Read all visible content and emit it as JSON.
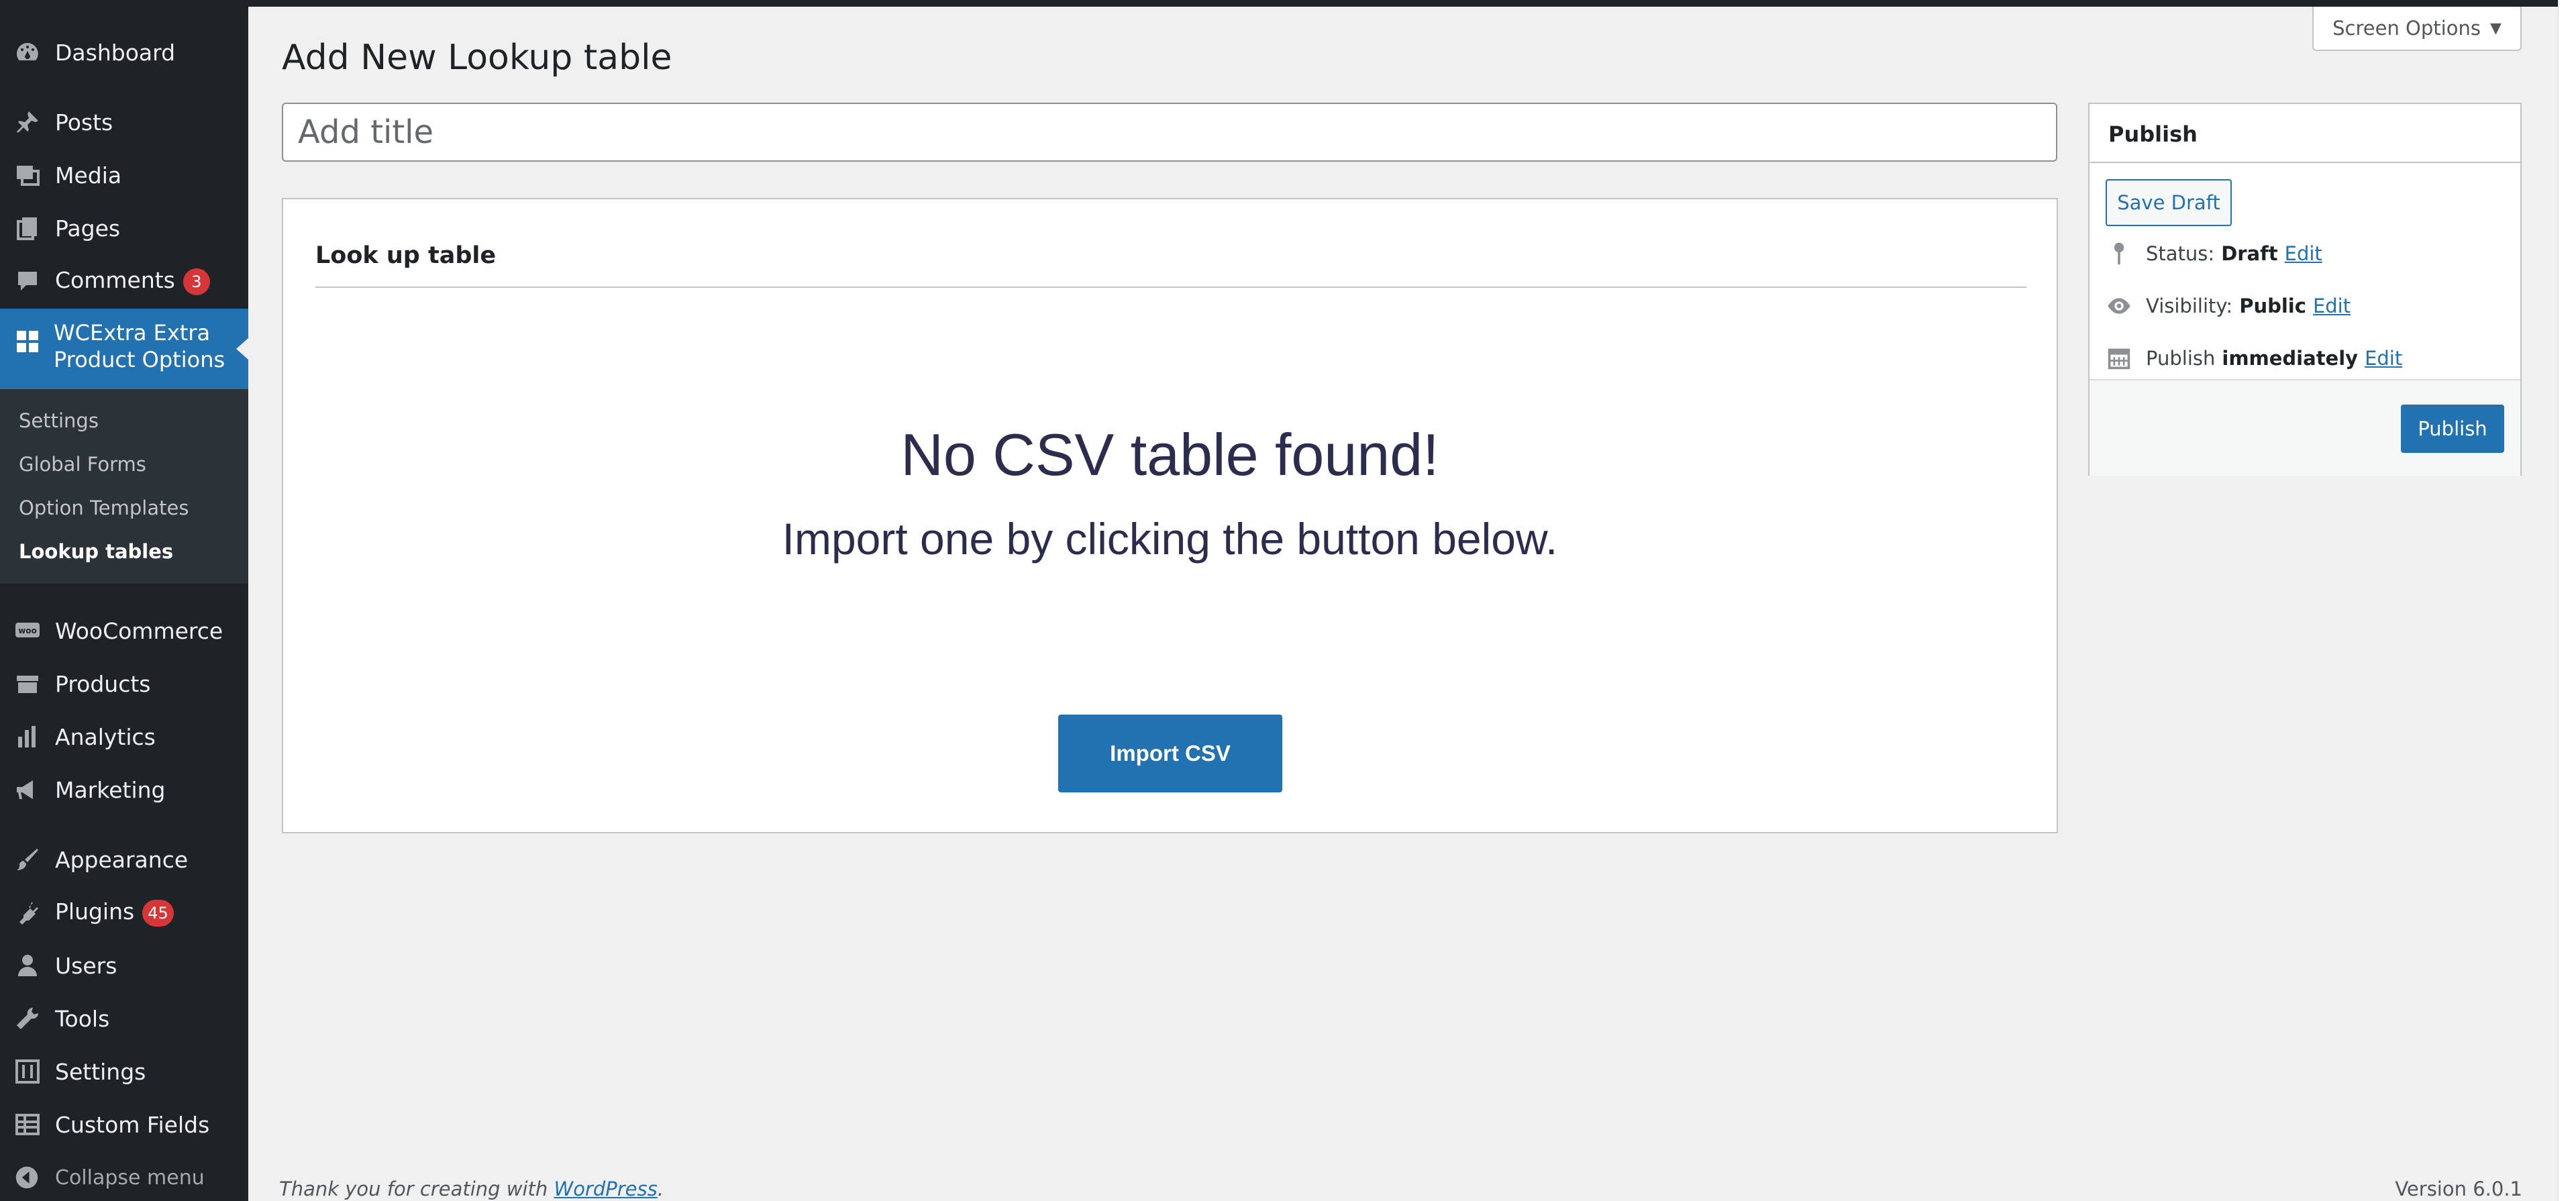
{
  "sidebar": {
    "items_top": [
      {
        "label": "Dashboard",
        "icon": "dashboard-icon"
      },
      {
        "label": "Posts",
        "icon": "pin-icon"
      },
      {
        "label": "Media",
        "icon": "media-icon"
      },
      {
        "label": "Pages",
        "icon": "pages-icon"
      },
      {
        "label": "Comments",
        "icon": "comment-icon",
        "badge": "3"
      }
    ],
    "active": {
      "label": "WCExtra Extra Product Options",
      "icon": "grid-icon"
    },
    "submenu": [
      {
        "label": "Settings"
      },
      {
        "label": "Global Forms"
      },
      {
        "label": "Option Templates"
      },
      {
        "label": "Lookup tables",
        "current": true
      }
    ],
    "items_bottom": [
      {
        "label": "WooCommerce",
        "icon": "woo-icon"
      },
      {
        "label": "Products",
        "icon": "archive-icon"
      },
      {
        "label": "Analytics",
        "icon": "chart-icon"
      },
      {
        "label": "Marketing",
        "icon": "megaphone-icon"
      },
      {
        "label": "Appearance",
        "icon": "brush-icon"
      },
      {
        "label": "Plugins",
        "icon": "plugin-icon",
        "badge": "45"
      },
      {
        "label": "Users",
        "icon": "user-icon"
      },
      {
        "label": "Tools",
        "icon": "wrench-icon"
      },
      {
        "label": "Settings",
        "icon": "sliders-icon"
      },
      {
        "label": "Custom Fields",
        "icon": "table-icon"
      }
    ],
    "collapse_label": "Collapse menu"
  },
  "header": {
    "screen_options": "Screen Options",
    "page_title": "Add New Lookup table",
    "title_placeholder": "Add title"
  },
  "lookup_box": {
    "title": "Look up table",
    "empty_heading": "No CSV table found!",
    "empty_sub": "Import one by clicking the button below.",
    "import_button": "Import CSV"
  },
  "publish": {
    "title": "Publish",
    "save_draft": "Save Draft",
    "status_label": "Status:",
    "status_value": "Draft",
    "visibility_label": "Visibility:",
    "visibility_value": "Public",
    "publish_label": "Publish",
    "publish_value": "immediately",
    "edit_label": "Edit",
    "publish_button": "Publish"
  },
  "footer": {
    "thanks_prefix": "Thank you for creating with ",
    "thanks_link": "WordPress",
    "thanks_suffix": ".",
    "version": "Version 6.0.1"
  },
  "colors": {
    "accent": "#2271b1",
    "sidebar_bg": "#1d2327",
    "badge": "#d63638"
  }
}
